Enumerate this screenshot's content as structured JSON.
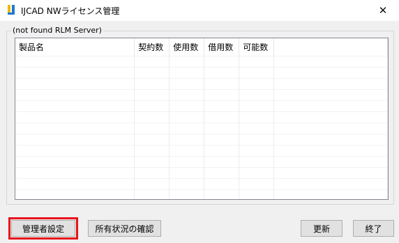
{
  "window": {
    "title": "IJCAD NWライセンス管理",
    "close_glyph": "✕",
    "icon": "ijcad-app-icon"
  },
  "group": {
    "label": "(not found RLM Server)"
  },
  "table": {
    "columns": [
      "製品名",
      "契約数",
      "使用数",
      "借用数",
      "可能数",
      ""
    ],
    "rows": []
  },
  "buttons": {
    "admin_settings": "管理者設定",
    "check_status": "所有状況の確認",
    "refresh": "更新",
    "exit": "終了"
  },
  "colors": {
    "highlight_border": "#e8121c",
    "icon_blue": "#1e78d2",
    "icon_yellow": "#f2b705"
  }
}
